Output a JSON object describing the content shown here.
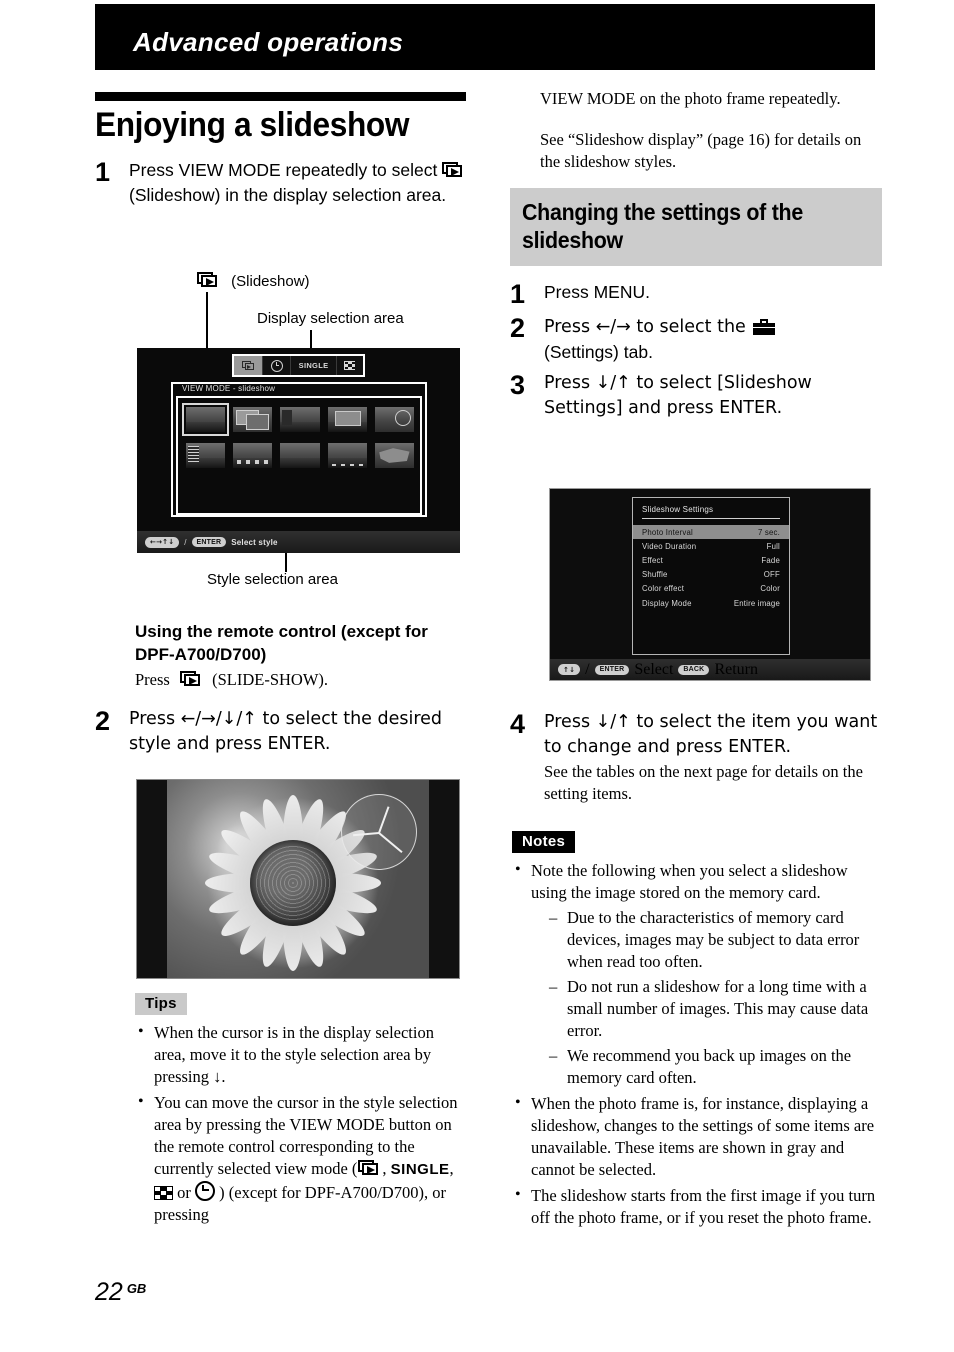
{
  "header": {
    "chapter": "Advanced operations"
  },
  "left": {
    "section_title": "Enjoying a slideshow",
    "step1": {
      "num": "1",
      "text_a": "Press VIEW MODE repeatedly to select",
      "icon": "slideshow-icon",
      "text_b": "(Slideshow) in the display selection area."
    },
    "callouts": {
      "slideshow_label": "(Slideshow)",
      "display_selection_area": "Display selection area",
      "style_selection_area": "Style selection area"
    },
    "viewmode_shot": {
      "tabs": [
        {
          "id": "slideshow-tab",
          "label": "",
          "icon": "slideshow-icon",
          "selected": true
        },
        {
          "id": "clock-tab",
          "label": "",
          "icon": "clock-icon",
          "selected": false
        },
        {
          "id": "single-tab",
          "label": "SINGLE",
          "icon": "",
          "selected": false
        },
        {
          "id": "multi-tab",
          "label": "",
          "icon": "multi-image-icon",
          "selected": false
        }
      ],
      "panel_label": "VIEW MODE - slideshow",
      "bottom_bar": {
        "dpad": "←→↑↓",
        "separator": "/",
        "enter": "ENTER",
        "action": "Select style"
      }
    },
    "remote_heading": "Using the remote control (except for DPF-A700/D700)",
    "remote_text_a": "Press",
    "remote_text_b": "(SLIDE-SHOW).",
    "step2": {
      "num": "2",
      "text": "Press ←/→/↓/↑ to select the desired style and press ENTER."
    },
    "tips": {
      "badge": "Tips",
      "items": [
        "When the cursor is in the display selection area, move it to the style selection area by pressing ↓.",
        "You can move the cursor in the style selection area by pressing the VIEW MODE button on the remote control corresponding to the currently selected view mode ("
      ],
      "item2_mid1": ",",
      "item2_single": "SINGLE",
      "item2_mid2": ",",
      "item2_or": "or",
      "item2_tail": ") (except for DPF-A700/D700), or pressing"
    }
  },
  "right": {
    "continued_1": "VIEW MODE on the photo frame repeatedly.",
    "continued_2": "See “Slideshow display” (page 16) for details on the slideshow styles.",
    "section_title": "Changing the settings of the slideshow",
    "step1": {
      "num": "1",
      "text": "Press MENU."
    },
    "step2": {
      "num": "2",
      "text_a": "Press ←/→ to select the",
      "text_b": "(Settings) tab.",
      "icon": "settings-toolbox-icon"
    },
    "step3": {
      "num": "3",
      "text": "Press ↓/↑ to select [Slideshow Settings] and press ENTER."
    },
    "settings_shot": {
      "title": "Slideshow Settings",
      "rows": [
        {
          "label": "Photo Interval",
          "value": "7 sec.",
          "selected": true
        },
        {
          "label": "Video Duration",
          "value": "Full",
          "selected": false
        },
        {
          "label": "Effect",
          "value": "Fade",
          "selected": false
        },
        {
          "label": "Shuffle",
          "value": "OFF",
          "selected": false
        },
        {
          "label": "Color effect",
          "value": "Color",
          "selected": false
        },
        {
          "label": "Display Mode",
          "value": "Entire image",
          "selected": false
        }
      ],
      "bottom_bar": {
        "dpad": "↑↓",
        "separator": "/",
        "enter": "ENTER",
        "action_select": "Select",
        "back": "BACK",
        "action_return": "Return"
      }
    },
    "step4": {
      "num": "4",
      "text_main": "Press ↓/↑ to select the item you want to change and press ENTER.",
      "text_sub": "See the tables on the next page for details on the setting items."
    },
    "notes": {
      "badge": "Notes",
      "item1": "Note the following when you select a slideshow using the image stored on the memory card.",
      "subitems": [
        "Due to the characteristics of memory card devices, images may be subject to data error when read too often.",
        "Do not run a slideshow for a long time with a small number of images. This may cause data error.",
        "We recommend you back up images on the memory card often."
      ],
      "item2": "When the photo frame is, for instance, displaying a slideshow, changes to the settings of some items are unavailable. These items are shown in gray and cannot be selected.",
      "item3": "The slideshow starts from the first image if you turn off the photo frame, or if you reset the photo frame."
    }
  },
  "footer": {
    "page_number": "22",
    "region": "GB"
  },
  "colors": {
    "header_bar": "#000000",
    "section_band": "#cccccc",
    "tips_badge": "#c9c9c9",
    "notes_badge": "#000000",
    "screen_bg": "#0a0a0a",
    "highlight_row": "#8e8e8e"
  }
}
